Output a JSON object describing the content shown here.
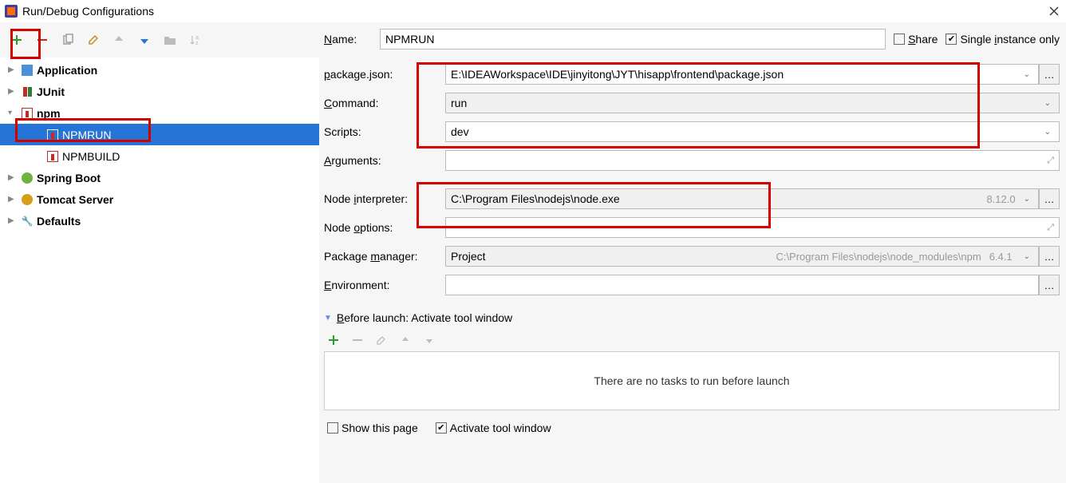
{
  "window": {
    "title": "Run/Debug Configurations"
  },
  "tree": {
    "items": [
      {
        "label": "Application",
        "icon": "app"
      },
      {
        "label": "JUnit",
        "icon": "junit"
      },
      {
        "label": "npm",
        "icon": "npm"
      },
      {
        "label": "Spring Boot",
        "icon": "spring"
      },
      {
        "label": "Tomcat Server",
        "icon": "tomcat"
      },
      {
        "label": "Defaults",
        "icon": "defaults"
      }
    ],
    "npm_children": [
      {
        "label": "NPMRUN"
      },
      {
        "label": "NPMBUILD"
      }
    ]
  },
  "topbar": {
    "name_label": "Name:",
    "name_value": "NPMRUN",
    "share_label": "Share",
    "single_label": "Single instance only"
  },
  "form": {
    "package_label": "package.json:",
    "package_value": "E:\\IDEAWorkspace\\IDE\\jinyitong\\JYT\\hisapp\\frontend\\package.json",
    "command_label": "Command:",
    "command_value": "run",
    "scripts_label": "Scripts:",
    "scripts_value": "dev",
    "arguments_label": "Arguments:",
    "arguments_value": "",
    "node_interpreter_label": "Node interpreter:",
    "node_interpreter_value": "C:\\Program Files\\nodejs\\node.exe",
    "node_version": "8.12.0",
    "node_options_label": "Node options:",
    "node_options_value": "",
    "pkg_mgr_label": "Package manager:",
    "pkg_mgr_value": "Project",
    "pkg_mgr_hint": "C:\\Program Files\\nodejs\\node_modules\\npm",
    "pkg_mgr_version": "6.4.1",
    "env_label": "Environment:",
    "env_value": ""
  },
  "before_launch": {
    "header": "Before launch: Activate tool window",
    "empty_text": "There are no tasks to run before launch",
    "show_this_page": "Show this page",
    "activate_tool_window": "Activate tool window"
  }
}
